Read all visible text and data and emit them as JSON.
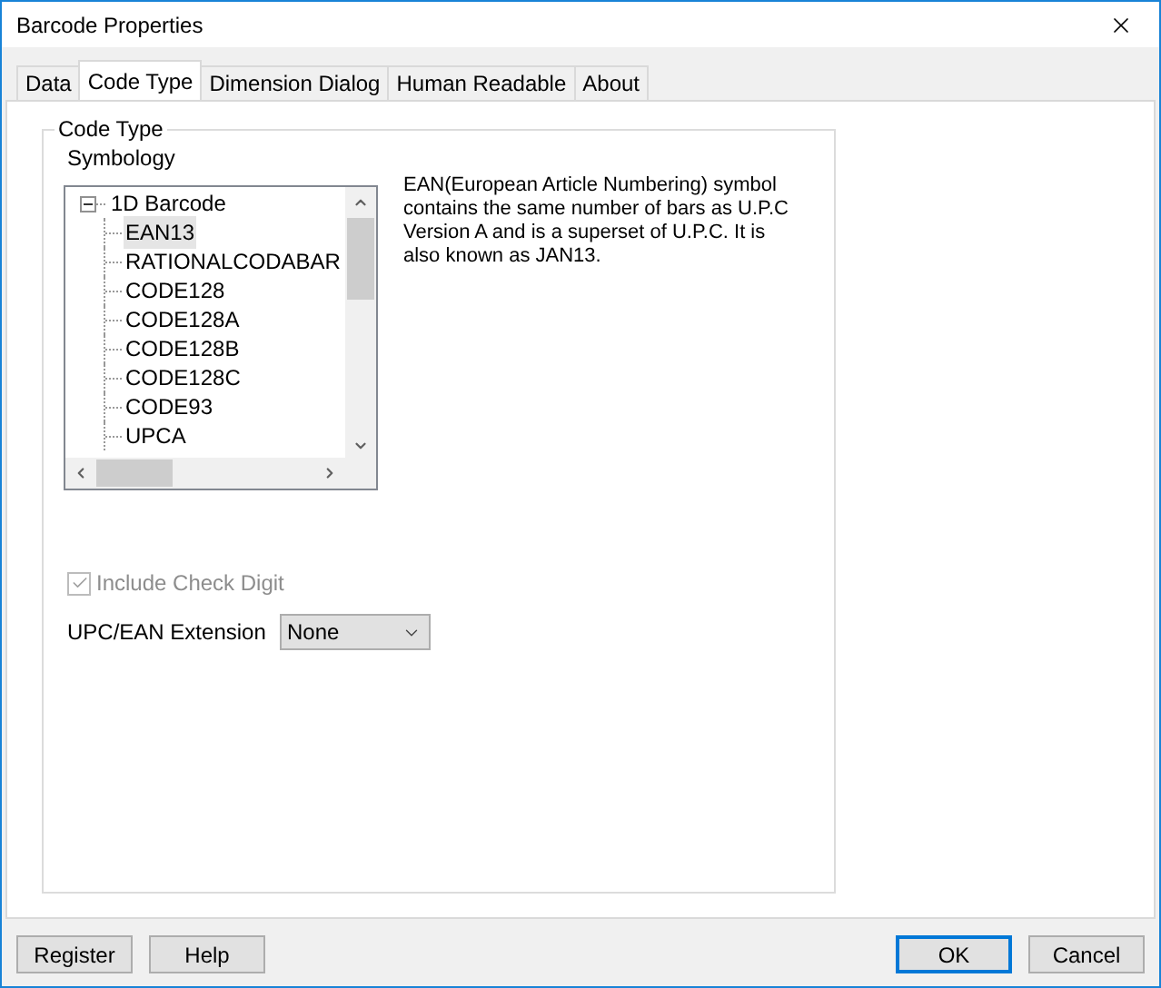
{
  "window": {
    "title": "Barcode Properties"
  },
  "tabs": [
    {
      "label": "Data",
      "selected": false
    },
    {
      "label": "Code Type",
      "selected": true
    },
    {
      "label": "Dimension Dialog",
      "selected": false
    },
    {
      "label": "Human Readable",
      "selected": false
    },
    {
      "label": "About",
      "selected": false
    }
  ],
  "group": {
    "title": "Code Type",
    "symbology_label": "Symbology",
    "tree": {
      "label": "1D Barcode",
      "expanded": true,
      "children": [
        {
          "label": "EAN13",
          "selected": true
        },
        {
          "label": "RATIONALCODABAR",
          "selected": false
        },
        {
          "label": "CODE128",
          "selected": false
        },
        {
          "label": "CODE128A",
          "selected": false
        },
        {
          "label": "CODE128B",
          "selected": false
        },
        {
          "label": "CODE128C",
          "selected": false
        },
        {
          "label": "CODE93",
          "selected": false
        },
        {
          "label": "UPCA",
          "selected": false
        }
      ]
    },
    "description": "EAN(European Article Numbering) symbol contains the same number of bars as U.P.C Version A and is a superset of U.P.C. It is also known as JAN13.",
    "check_digit": {
      "label": "Include Check Digit",
      "checked": true,
      "disabled": true
    },
    "extension": {
      "label": "UPC/EAN Extension",
      "value": "None"
    }
  },
  "buttons_left": [
    "Register",
    "Help"
  ],
  "buttons_right": [
    {
      "label": "OK",
      "default": true
    },
    {
      "label": "Cancel",
      "default": false
    }
  ]
}
